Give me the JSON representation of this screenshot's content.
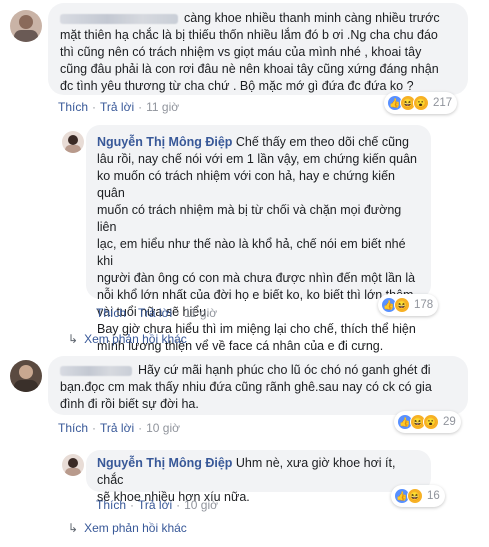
{
  "comment1": {
    "line1": "càng khoe nhiều thanh minh càng nhiều trước",
    "line2": "mặt thiên hạ chắc là bị thiếu thốn nhiều lắm đó b ơi .Ng cha chu đáo",
    "line3": "thì cũng nên có trách nhiệm vs giọt máu của mình nhé , khoai tây",
    "line4": "cũng đâu phải là con rơi đâu nè nên khoai tây cũng xứng đáng nhận",
    "line5": "đc tình yêu thương từ cha chứ . Bộ mặc mớ gì đứa đc đứa ko ?",
    "like": "Thích",
    "reply": "Trả lời",
    "time": "11 giờ",
    "reaction_count": "217",
    "reaction_icons": [
      "like-icon",
      "haha-icon",
      "wow-icon"
    ]
  },
  "reply1": {
    "author": "Nguyễn Thị Mông Điệp",
    "p1": [
      "Chế thấy em theo dõi chế cũng",
      "lâu rồi, nay chế nói với em 1 lần vậy, em chứng kiến quân",
      "ko muốn có trách nhiệm với con hả, hay e chứng kiến quân",
      "muốn có trách nhiệm mà bị từ chối và chặn mọi đường liên",
      "lạc, em hiểu như thế nào là khổ hả, chế nói em biết nhé khi",
      "người đàn ông có con mà chưa được nhìn đến một lần là",
      "nỗi khổ lớn nhất của đời họ e biết ko, ko biết thì lớn thêm",
      "vài tuổi nữa sẽ hiểu."
    ],
    "p2": [
      "Bay giờ chưa hiểu thì im miệng lại cho chế, thích thể hiện",
      "mình lương thiện vể về face cá nhân của e đi cưng."
    ],
    "like": "Thích",
    "reply": "Trả lời",
    "time": "11 giờ",
    "reaction_count": "178",
    "reaction_icons": [
      "like-icon",
      "haha-icon"
    ]
  },
  "more_replies_1": "Xem phản hồi khác",
  "comment2": {
    "line1": "Hãy cứ mãi hạnh phúc cho lũ óc chó nó ganh ghét đi",
    "line2": "bạn.đọc cm mak thấy nhiu đứa cũng rãnh ghê.sau nay có ck có gia",
    "line3": "đình đi rồi biết sự đời ha.",
    "like": "Thích",
    "reply": "Trả lời",
    "time": "10 giờ",
    "reaction_count": "29",
    "reaction_icons": [
      "like-icon",
      "haha-icon",
      "wow-icon"
    ]
  },
  "reply2": {
    "author": "Nguyễn Thị Mông Điệp",
    "line1": "Uhm nè, xưa giờ khoe hơi ít, chắc",
    "line2": "sẽ khoe nhiều hơn xíu nữa.",
    "like": "Thích",
    "reply": "Trả lời",
    "time": "10 giờ",
    "reaction_count": "16",
    "reaction_icons": [
      "like-icon",
      "haha-icon"
    ]
  },
  "more_replies_2": "Xem phản hồi khác"
}
